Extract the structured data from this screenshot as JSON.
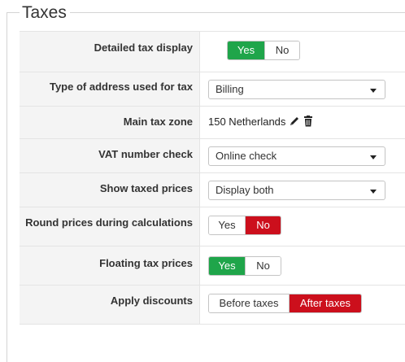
{
  "fieldset": {
    "legend": "Taxes"
  },
  "rows": {
    "detailed_tax_display": {
      "label": "Detailed tax display",
      "options": [
        "Yes",
        "No"
      ],
      "selected": "Yes"
    },
    "address_type": {
      "label": "Type of address used for tax",
      "value": "Billing"
    },
    "main_tax_zone": {
      "label": "Main tax zone",
      "value": "150 Netherlands",
      "icons": [
        "pencil-icon",
        "trash-icon"
      ]
    },
    "vat_number_check": {
      "label": "VAT number check",
      "value": "Online check"
    },
    "show_taxed_prices": {
      "label": "Show taxed prices",
      "value": "Display both"
    },
    "round_prices": {
      "label": "Round prices during calculations",
      "options": [
        "Yes",
        "No"
      ],
      "selected": "No"
    },
    "floating_tax_prices": {
      "label": "Floating tax prices",
      "options": [
        "Yes",
        "No"
      ],
      "selected": "Yes"
    },
    "apply_discounts": {
      "label": "Apply discounts",
      "options": [
        "Before taxes",
        "After taxes"
      ],
      "selected": "After taxes"
    }
  },
  "colors": {
    "selected_yes": "#1fa54a",
    "selected_no": "#cc0f1c"
  }
}
